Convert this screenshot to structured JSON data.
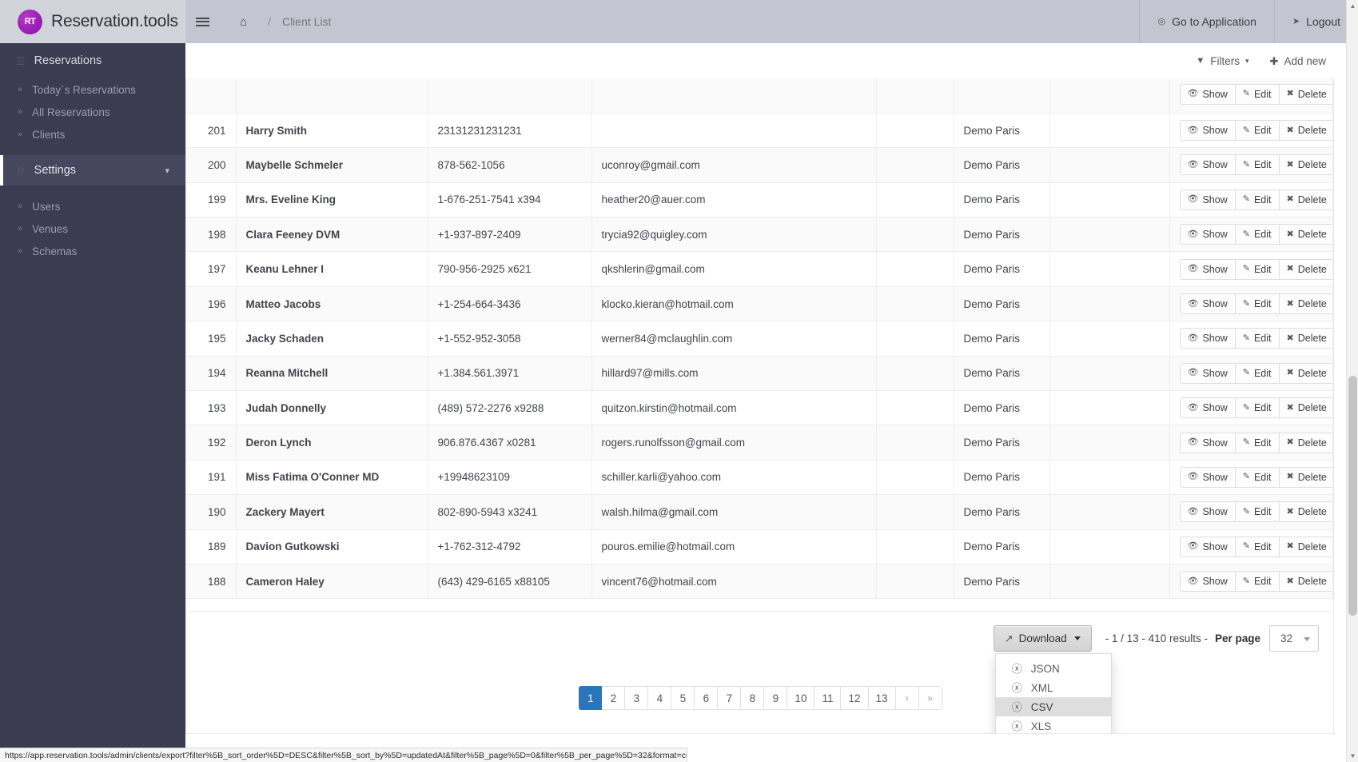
{
  "topbar": {
    "brand_initials": "RT",
    "brand_title": "Reservation.tools",
    "breadcrumb_home_icon": "home-icon",
    "breadcrumb_separator": "/",
    "breadcrumb_current": "Client List",
    "go_to_application": "Go to Application",
    "logout": "Logout"
  },
  "sidebar": {
    "header": {
      "label": "Reservations",
      "icon": "list-icon"
    },
    "items": [
      {
        "label": "Today`s Reservations"
      },
      {
        "label": "All Reservations"
      },
      {
        "label": "Clients"
      }
    ],
    "settings": {
      "label": "Settings",
      "icon": "gears-icon",
      "caret": "chevron-down-icon"
    },
    "settings_items": [
      {
        "label": "Users"
      },
      {
        "label": "Venues"
      },
      {
        "label": "Schemas"
      }
    ]
  },
  "toolbar": {
    "filters_label": "Filters",
    "filters_icon": "funnel-icon",
    "add_new_label": "Add new",
    "add_new_icon": "plus-circle-icon"
  },
  "table": {
    "row_actions": {
      "show": "Show",
      "edit": "Edit",
      "delete": "Delete",
      "show_icon": "eye-icon",
      "edit_icon": "pencil-icon",
      "delete_icon": "times-icon"
    },
    "rows": [
      {
        "id": "",
        "name": "",
        "phone": "",
        "email": "",
        "venue": "",
        "clipped": true
      },
      {
        "id": "201",
        "name": "Harry Smith",
        "phone": "23131231231231",
        "email": "",
        "venue": "Demo Paris"
      },
      {
        "id": "200",
        "name": "Maybelle Schmeler",
        "phone": "878-562-1056",
        "email": "uconroy@gmail.com",
        "venue": "Demo Paris"
      },
      {
        "id": "199",
        "name": "Mrs. Eveline King",
        "phone": "1-676-251-7541 x394",
        "email": "heather20@auer.com",
        "venue": "Demo Paris"
      },
      {
        "id": "198",
        "name": "Clara Feeney DVM",
        "phone": "+1-937-897-2409",
        "email": "trycia92@quigley.com",
        "venue": "Demo Paris"
      },
      {
        "id": "197",
        "name": "Keanu Lehner I",
        "phone": "790-956-2925 x621",
        "email": "qkshlerin@gmail.com",
        "venue": "Demo Paris"
      },
      {
        "id": "196",
        "name": "Matteo Jacobs",
        "phone": "+1-254-664-3436",
        "email": "klocko.kieran@hotmail.com",
        "venue": "Demo Paris"
      },
      {
        "id": "195",
        "name": "Jacky Schaden",
        "phone": "+1-552-952-3058",
        "email": "werner84@mclaughlin.com",
        "venue": "Demo Paris"
      },
      {
        "id": "194",
        "name": "Reanna Mitchell",
        "phone": "+1.384.561.3971",
        "email": "hillard97@mills.com",
        "venue": "Demo Paris"
      },
      {
        "id": "193",
        "name": "Judah Donnelly",
        "phone": "(489) 572-2276 x9288",
        "email": "quitzon.kirstin@hotmail.com",
        "venue": "Demo Paris"
      },
      {
        "id": "192",
        "name": "Deron Lynch",
        "phone": "906.876.4367 x0281",
        "email": "rogers.runolfsson@gmail.com",
        "venue": "Demo Paris"
      },
      {
        "id": "191",
        "name": "Miss Fatima O'Conner MD",
        "phone": "+19948623109",
        "email": "schiller.karli@yahoo.com",
        "venue": "Demo Paris"
      },
      {
        "id": "190",
        "name": "Zackery Mayert",
        "phone": "802-890-5943 x3241",
        "email": "walsh.hilma@gmail.com",
        "venue": "Demo Paris"
      },
      {
        "id": "189",
        "name": "Davion Gutkowski",
        "phone": "+1-762-312-4792",
        "email": "pouros.emilie@hotmail.com",
        "venue": "Demo Paris"
      },
      {
        "id": "188",
        "name": "Cameron Haley",
        "phone": "(643) 429-6165 x88105",
        "email": "vincent76@hotmail.com",
        "venue": "Demo Paris"
      }
    ]
  },
  "footer": {
    "download_label": "Download",
    "download_icon": "share-square-icon",
    "download_menu": [
      {
        "label": "JSON",
        "icon": "download-circle-icon",
        "active": false
      },
      {
        "label": "XML",
        "icon": "download-circle-icon",
        "active": false
      },
      {
        "label": "CSV",
        "icon": "download-circle-icon",
        "active": true
      },
      {
        "label": "XLS",
        "icon": "download-circle-icon",
        "active": false
      }
    ],
    "results_text": "-  1 / 13  -  410 results  -",
    "per_page_label": "Per page",
    "per_page_value": "32"
  },
  "pagination": {
    "pages": [
      "1",
      "2",
      "3",
      "4",
      "5",
      "6",
      "7",
      "8",
      "9",
      "10",
      "11",
      "12",
      "13"
    ],
    "active_page": "1",
    "next_label": "›",
    "last_label": "»"
  },
  "statusbar": {
    "url": "https://app.reservation.tools/admin/clients/export?filter%5B_sort_order%5D=DESC&filter%5B_sort_by%5D=updatedAt&filter%5B_page%5D=0&filter%5B_per_page%5D=32&format=csv"
  },
  "colors": {
    "sidebar_bg": "#3b3b52",
    "topbar_bg": "#c3c6d0",
    "accent_blue": "#2a76ba",
    "brand_purple": "#9b22b5"
  }
}
